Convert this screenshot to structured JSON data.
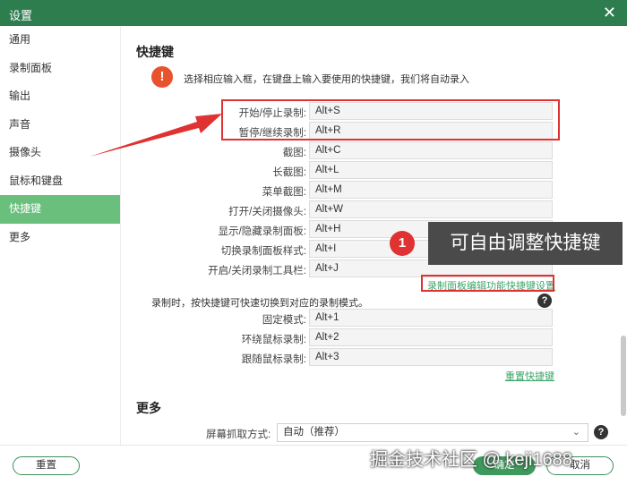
{
  "window": {
    "title": "设置"
  },
  "sidebar": {
    "items": [
      {
        "label": "通用"
      },
      {
        "label": "录制面板"
      },
      {
        "label": "输出"
      },
      {
        "label": "声音"
      },
      {
        "label": "摄像头"
      },
      {
        "label": "鼠标和键盘"
      },
      {
        "label": "快捷键",
        "active": true
      },
      {
        "label": "更多"
      }
    ]
  },
  "hotkeys": {
    "title": "快捷键",
    "tip": "选择相应输入框，在键盘上输入要使用的快捷键，我们将自动录入",
    "rows": [
      {
        "label": "开始/停止录制:",
        "value": "Alt+S"
      },
      {
        "label": "暂停/继续录制:",
        "value": "Alt+R"
      },
      {
        "label": "截图:",
        "value": "Alt+C"
      },
      {
        "label": "长截图:",
        "value": "Alt+L"
      },
      {
        "label": "菜单截图:",
        "value": "Alt+M"
      },
      {
        "label": "打开/关闭摄像头:",
        "value": "Alt+W"
      },
      {
        "label": "显示/隐藏录制面板:",
        "value": "Alt+H"
      },
      {
        "label": "切换录制面板样式:",
        "value": "Alt+I"
      },
      {
        "label": "开启/关闭录制工具栏:",
        "value": "Alt+J"
      }
    ],
    "edit_link": "录制面板编辑功能快捷键设置",
    "mode_note": "录制时，按快捷键可快速切换到对应的录制模式。",
    "mode_rows": [
      {
        "label": "固定模式:",
        "value": "Alt+1"
      },
      {
        "label": "环绕鼠标录制:",
        "value": "Alt+2"
      },
      {
        "label": "跟随鼠标录制:",
        "value": "Alt+3"
      }
    ],
    "reset_link": "重置快捷键"
  },
  "more": {
    "title": "更多",
    "capture_label": "屏幕抓取方式:",
    "capture_value": "自动（推荐）"
  },
  "footer": {
    "reset": "重置",
    "ok": "确定",
    "cancel": "取消"
  },
  "annotation": {
    "badge": "1",
    "callout": "可自由调整快捷键",
    "color": "#e03232"
  },
  "watermark": "掘金技术社区 @ keji1688"
}
